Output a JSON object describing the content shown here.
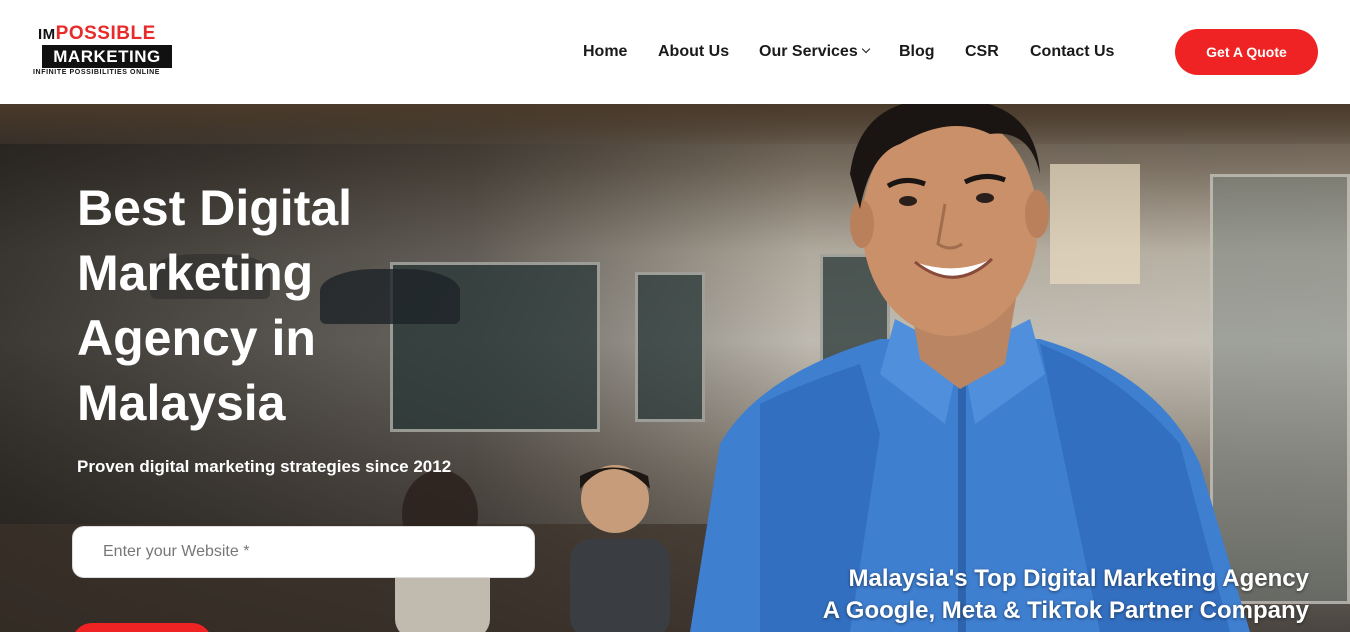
{
  "logo": {
    "im": "IM",
    "possible": "POSSIBLE",
    "marketing": "MARKETING",
    "tagline": "INFINITE POSSIBILITIES ONLINE"
  },
  "nav": {
    "items": [
      {
        "label": "Home"
      },
      {
        "label": "About Us"
      },
      {
        "label": "Our Services"
      },
      {
        "label": "Blog"
      },
      {
        "label": "CSR"
      },
      {
        "label": "Contact Us"
      }
    ],
    "cta": "Get A Quote"
  },
  "hero": {
    "title": "Best Digital Marketing Agency in Malaysia",
    "subtitle": "Proven digital marketing strategies since 2012",
    "input_placeholder": "Enter your Website *",
    "tagline_1": "Malaysia's Top Digital Marketing Agency",
    "tagline_2": "A Google, Meta & TikTok Partner Company"
  },
  "colors": {
    "brand_red": "#ef2323",
    "text_dark": "#1a1a1a",
    "shirt_blue": "#3f7fd0"
  },
  "icons": {
    "services_dropdown": "chevron-down-icon"
  }
}
